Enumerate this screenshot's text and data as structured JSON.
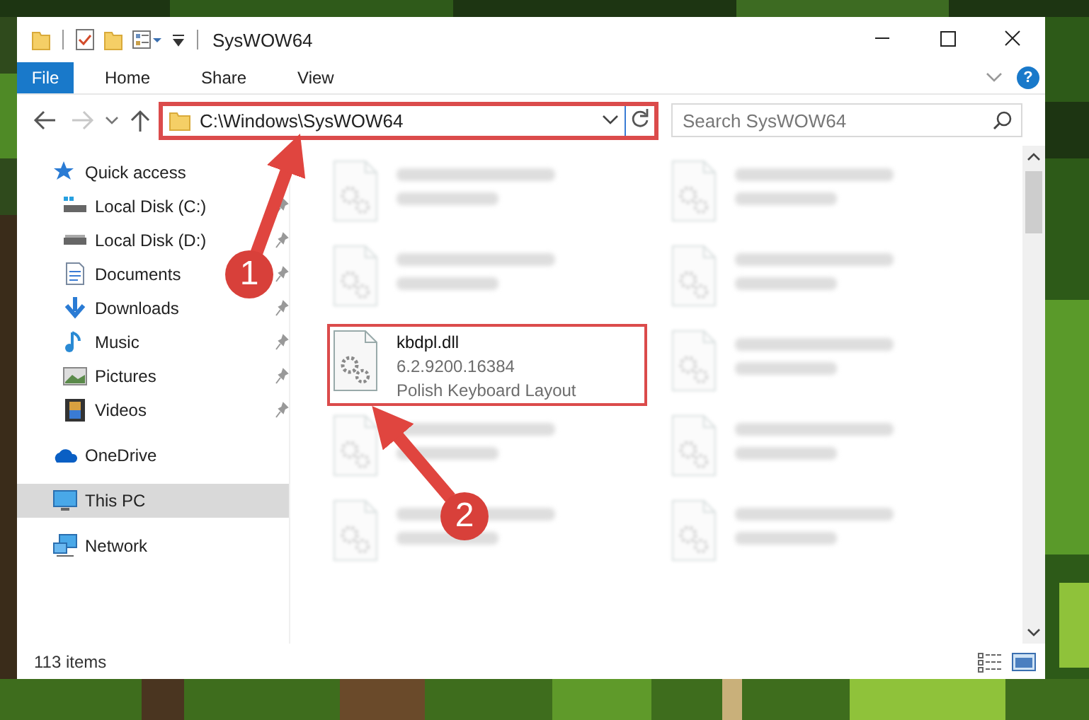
{
  "window": {
    "title": "SysWOW64"
  },
  "ribbon": {
    "file_tab": "File",
    "tabs": [
      {
        "label": "Home",
        "selected": false
      },
      {
        "label": "Share",
        "selected": false
      },
      {
        "label": "View",
        "selected": false
      }
    ],
    "help": "?"
  },
  "address": {
    "path": "C:\\Windows\\SysWOW64",
    "highlighted": true
  },
  "search": {
    "placeholder": "Search SysWOW64"
  },
  "sidebar": {
    "items": [
      {
        "label": "Quick access",
        "selected": false,
        "children": [
          {
            "label": "Local Disk (C:)",
            "pinned": true,
            "selected": false
          },
          {
            "label": "Local Disk (D:)",
            "pinned": true,
            "selected": false
          },
          {
            "label": "Documents",
            "pinned": true,
            "selected": false
          },
          {
            "label": "Downloads",
            "pinned": true,
            "selected": false
          },
          {
            "label": "Music",
            "pinned": true,
            "selected": false
          },
          {
            "label": "Pictures",
            "pinned": true,
            "selected": false
          },
          {
            "label": "Videos",
            "pinned": true,
            "selected": false
          }
        ]
      },
      {
        "label": "OneDrive",
        "selected": false
      },
      {
        "label": "This PC",
        "selected": true
      },
      {
        "label": "Network",
        "selected": false
      }
    ]
  },
  "files": [
    {
      "blurred": true,
      "highlighted": false
    },
    {
      "blurred": true,
      "highlighted": false
    },
    {
      "blurred": true,
      "highlighted": false
    },
    {
      "blurred": true,
      "highlighted": false
    },
    {
      "name": "kbdpl.dll",
      "details": [
        "6.2.9200.16384",
        "Polish Keyboard Layout"
      ],
      "blurred": false,
      "highlighted": true
    },
    {
      "blurred": true,
      "highlighted": false
    },
    {
      "blurred": true,
      "highlighted": false
    },
    {
      "blurred": true,
      "highlighted": false
    },
    {
      "blurred": true,
      "highlighted": false
    },
    {
      "blurred": true,
      "highlighted": false
    }
  ],
  "status_bar": {
    "item_count": "113 items"
  },
  "annotations": [
    {
      "number": "1"
    },
    {
      "number": "2"
    }
  ]
}
